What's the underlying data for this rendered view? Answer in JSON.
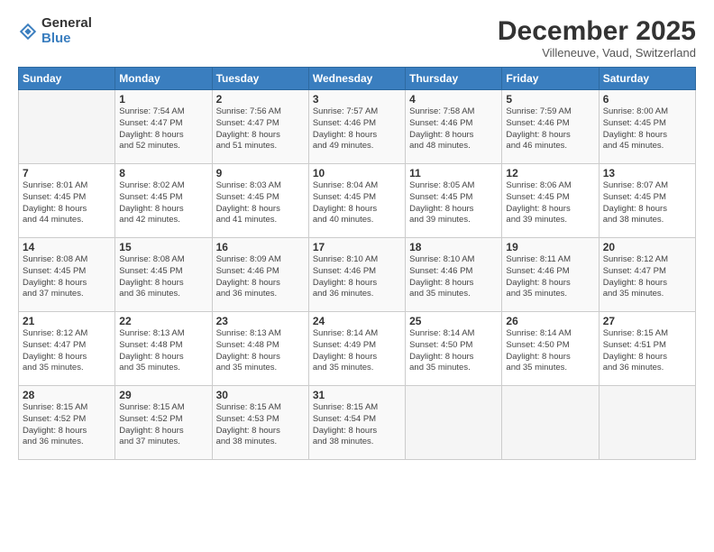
{
  "logo": {
    "general": "General",
    "blue": "Blue"
  },
  "header": {
    "month": "December 2025",
    "location": "Villeneuve, Vaud, Switzerland"
  },
  "days_of_week": [
    "Sunday",
    "Monday",
    "Tuesday",
    "Wednesday",
    "Thursday",
    "Friday",
    "Saturday"
  ],
  "weeks": [
    [
      {
        "day": "",
        "info": ""
      },
      {
        "day": "1",
        "info": "Sunrise: 7:54 AM\nSunset: 4:47 PM\nDaylight: 8 hours\nand 52 minutes."
      },
      {
        "day": "2",
        "info": "Sunrise: 7:56 AM\nSunset: 4:47 PM\nDaylight: 8 hours\nand 51 minutes."
      },
      {
        "day": "3",
        "info": "Sunrise: 7:57 AM\nSunset: 4:46 PM\nDaylight: 8 hours\nand 49 minutes."
      },
      {
        "day": "4",
        "info": "Sunrise: 7:58 AM\nSunset: 4:46 PM\nDaylight: 8 hours\nand 48 minutes."
      },
      {
        "day": "5",
        "info": "Sunrise: 7:59 AM\nSunset: 4:46 PM\nDaylight: 8 hours\nand 46 minutes."
      },
      {
        "day": "6",
        "info": "Sunrise: 8:00 AM\nSunset: 4:45 PM\nDaylight: 8 hours\nand 45 minutes."
      }
    ],
    [
      {
        "day": "7",
        "info": "Sunrise: 8:01 AM\nSunset: 4:45 PM\nDaylight: 8 hours\nand 44 minutes."
      },
      {
        "day": "8",
        "info": "Sunrise: 8:02 AM\nSunset: 4:45 PM\nDaylight: 8 hours\nand 42 minutes."
      },
      {
        "day": "9",
        "info": "Sunrise: 8:03 AM\nSunset: 4:45 PM\nDaylight: 8 hours\nand 41 minutes."
      },
      {
        "day": "10",
        "info": "Sunrise: 8:04 AM\nSunset: 4:45 PM\nDaylight: 8 hours\nand 40 minutes."
      },
      {
        "day": "11",
        "info": "Sunrise: 8:05 AM\nSunset: 4:45 PM\nDaylight: 8 hours\nand 39 minutes."
      },
      {
        "day": "12",
        "info": "Sunrise: 8:06 AM\nSunset: 4:45 PM\nDaylight: 8 hours\nand 39 minutes."
      },
      {
        "day": "13",
        "info": "Sunrise: 8:07 AM\nSunset: 4:45 PM\nDaylight: 8 hours\nand 38 minutes."
      }
    ],
    [
      {
        "day": "14",
        "info": "Sunrise: 8:08 AM\nSunset: 4:45 PM\nDaylight: 8 hours\nand 37 minutes."
      },
      {
        "day": "15",
        "info": "Sunrise: 8:08 AM\nSunset: 4:45 PM\nDaylight: 8 hours\nand 36 minutes."
      },
      {
        "day": "16",
        "info": "Sunrise: 8:09 AM\nSunset: 4:46 PM\nDaylight: 8 hours\nand 36 minutes."
      },
      {
        "day": "17",
        "info": "Sunrise: 8:10 AM\nSunset: 4:46 PM\nDaylight: 8 hours\nand 36 minutes."
      },
      {
        "day": "18",
        "info": "Sunrise: 8:10 AM\nSunset: 4:46 PM\nDaylight: 8 hours\nand 35 minutes."
      },
      {
        "day": "19",
        "info": "Sunrise: 8:11 AM\nSunset: 4:46 PM\nDaylight: 8 hours\nand 35 minutes."
      },
      {
        "day": "20",
        "info": "Sunrise: 8:12 AM\nSunset: 4:47 PM\nDaylight: 8 hours\nand 35 minutes."
      }
    ],
    [
      {
        "day": "21",
        "info": "Sunrise: 8:12 AM\nSunset: 4:47 PM\nDaylight: 8 hours\nand 35 minutes."
      },
      {
        "day": "22",
        "info": "Sunrise: 8:13 AM\nSunset: 4:48 PM\nDaylight: 8 hours\nand 35 minutes."
      },
      {
        "day": "23",
        "info": "Sunrise: 8:13 AM\nSunset: 4:48 PM\nDaylight: 8 hours\nand 35 minutes."
      },
      {
        "day": "24",
        "info": "Sunrise: 8:14 AM\nSunset: 4:49 PM\nDaylight: 8 hours\nand 35 minutes."
      },
      {
        "day": "25",
        "info": "Sunrise: 8:14 AM\nSunset: 4:50 PM\nDaylight: 8 hours\nand 35 minutes."
      },
      {
        "day": "26",
        "info": "Sunrise: 8:14 AM\nSunset: 4:50 PM\nDaylight: 8 hours\nand 35 minutes."
      },
      {
        "day": "27",
        "info": "Sunrise: 8:15 AM\nSunset: 4:51 PM\nDaylight: 8 hours\nand 36 minutes."
      }
    ],
    [
      {
        "day": "28",
        "info": "Sunrise: 8:15 AM\nSunset: 4:52 PM\nDaylight: 8 hours\nand 36 minutes."
      },
      {
        "day": "29",
        "info": "Sunrise: 8:15 AM\nSunset: 4:52 PM\nDaylight: 8 hours\nand 37 minutes."
      },
      {
        "day": "30",
        "info": "Sunrise: 8:15 AM\nSunset: 4:53 PM\nDaylight: 8 hours\nand 38 minutes."
      },
      {
        "day": "31",
        "info": "Sunrise: 8:15 AM\nSunset: 4:54 PM\nDaylight: 8 hours\nand 38 minutes."
      },
      {
        "day": "",
        "info": ""
      },
      {
        "day": "",
        "info": ""
      },
      {
        "day": "",
        "info": ""
      }
    ]
  ]
}
